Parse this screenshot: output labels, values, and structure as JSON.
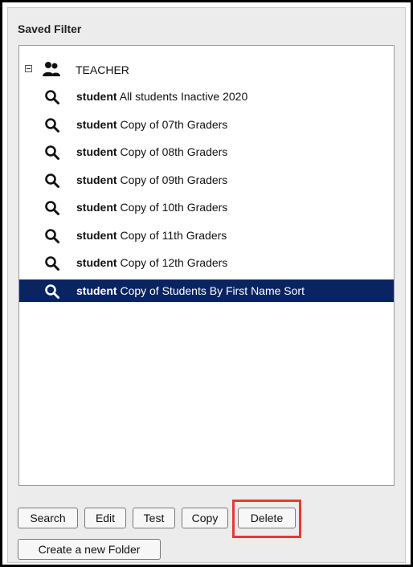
{
  "panel": {
    "title": "Saved Filter"
  },
  "tree": {
    "root": {
      "label": "TEACHER",
      "icon": "people-icon",
      "expander": "collapse-icon"
    },
    "items": [
      {
        "type": "student",
        "label": "All students Inactive 2020"
      },
      {
        "type": "student",
        "label": "Copy of 07th Graders"
      },
      {
        "type": "student",
        "label": "Copy of 08th Graders"
      },
      {
        "type": "student",
        "label": "Copy of 09th Graders"
      },
      {
        "type": "student",
        "label": "Copy of 10th Graders"
      },
      {
        "type": "student",
        "label": "Copy of 11th Graders"
      },
      {
        "type": "student",
        "label": "Copy of 12th Graders"
      },
      {
        "type": "student",
        "label": "Copy of Students By First Name Sort"
      }
    ],
    "selected_index": 7,
    "selected_color": "#0a2462"
  },
  "buttons": {
    "search": "Search",
    "edit": "Edit",
    "test": "Test",
    "copy": "Copy",
    "delete": "Delete",
    "new_folder": "Create a new Folder"
  },
  "highlight_color": "#e53935"
}
